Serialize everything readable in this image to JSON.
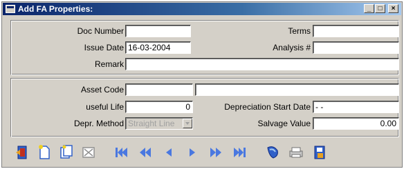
{
  "window": {
    "title": "Add FA Properties:"
  },
  "header_group": {
    "doc_number_label": "Doc Number",
    "doc_number_value": "",
    "issue_date_label": "Issue Date",
    "issue_date_value": "16-03-2004",
    "remark_label": "Remark",
    "remark_value": "",
    "terms_label": "Terms",
    "terms_value": "",
    "analysis_label": "Analysis #",
    "analysis_value": ""
  },
  "asset_group": {
    "asset_code_label": "Asset Code",
    "asset_code_value": "",
    "asset_desc_value": "",
    "useful_life_label": "useful Life",
    "useful_life_value": "0",
    "depr_method_label": "Depr. Method",
    "depr_method_value": "Straight Line",
    "depr_start_label": "Depreciation Start Date",
    "depr_start_value": "- -",
    "salvage_label": "Salvage Value",
    "salvage_value": "0.00"
  },
  "toolbar": {
    "buttons": [
      "exit-icon",
      "new-icon",
      "copy-icon",
      "delete-icon",
      "first-icon",
      "rewind-icon",
      "prev-icon",
      "next-icon",
      "fast-forward-icon",
      "last-icon",
      "search-icon",
      "print-icon",
      "save-icon"
    ]
  },
  "colors": {
    "title_start": "#0a246a",
    "title_end": "#a6caf0",
    "face": "#d4d0c8",
    "icon_blue": "#3060c8"
  }
}
